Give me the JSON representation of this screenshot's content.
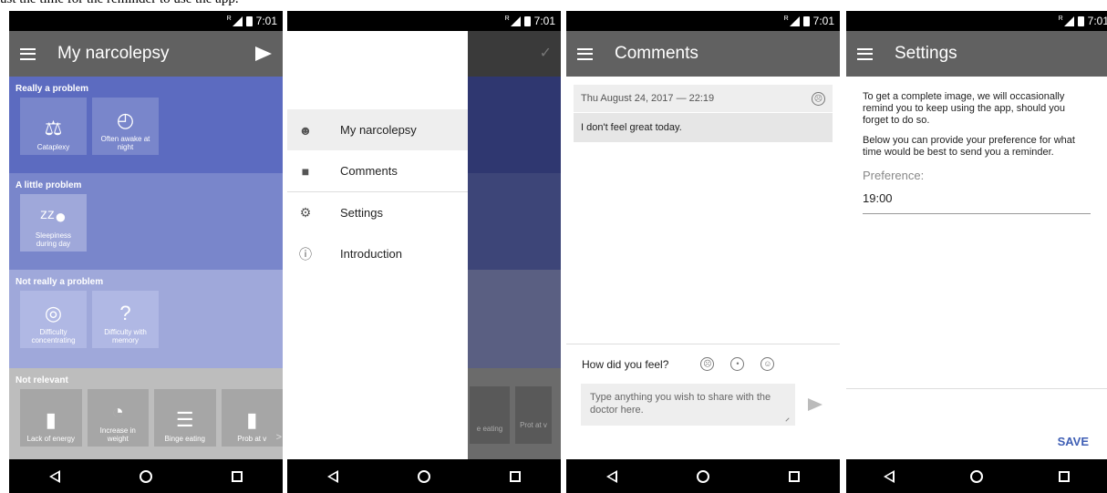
{
  "caption": "ust the time for the reminder to use the app.",
  "status": {
    "time": "7:01"
  },
  "screen1": {
    "title": "My narcolepsy",
    "sections": [
      {
        "header": "Really a problem",
        "color": "#5c6bc0",
        "tile_color": "#7986cb",
        "tiles": [
          {
            "icon": "⚖",
            "label": "Cataplexy"
          },
          {
            "icon": "◴",
            "label": "Often awake at night"
          }
        ]
      },
      {
        "header": "A little problem",
        "color": "#7986cb",
        "tile_color": "#9fa8da",
        "tiles": [
          {
            "icon": "ᶻᶻ●",
            "label": "Sleepiness during day"
          }
        ]
      },
      {
        "header": "Not really a problem",
        "color": "#9fa8da",
        "tile_color": "#b0b8e4",
        "tiles": [
          {
            "icon": "◎",
            "label": "Difficulty concentrating"
          },
          {
            "icon": "?",
            "label": "Difficulty with memory"
          }
        ]
      },
      {
        "header": "Not relevant",
        "color": "#bdbdbd",
        "tile_color": "#a6a6a6",
        "tiles": [
          {
            "icon": "▮",
            "label": "Lack of energy"
          },
          {
            "icon": "◔",
            "label": "Increase in weight"
          },
          {
            "icon": "☰",
            "label": "Binge eating"
          },
          {
            "icon": "▮",
            "label": "Prob at v"
          }
        ]
      }
    ]
  },
  "screen2": {
    "menu": [
      {
        "icon": "face-icon",
        "label": "My narcolepsy"
      },
      {
        "icon": "comment-icon",
        "label": "Comments"
      },
      {
        "icon": "gear-icon",
        "label": "Settings"
      },
      {
        "icon": "info-icon",
        "label": "Introduction"
      }
    ],
    "bg_label": "e eating",
    "bg_label2": "Prot at v"
  },
  "screen3": {
    "title": "Comments",
    "entry_date": "Thu August 24, 2017 — 22:19",
    "entry_text": "I don't feel great today.",
    "feel_question": "How did you feel?",
    "input_placeholder": "Type anything you wish to share with the doctor here."
  },
  "screen4": {
    "title": "Settings",
    "para1": "To get a complete image, we will occasionally remind you to keep using the app, should you forget to do so.",
    "para2": "Below you can provide your preference for what time would be best to send you a reminder.",
    "pref_label": "Preference:",
    "pref_value": "19:00",
    "save_label": "SAVE"
  }
}
